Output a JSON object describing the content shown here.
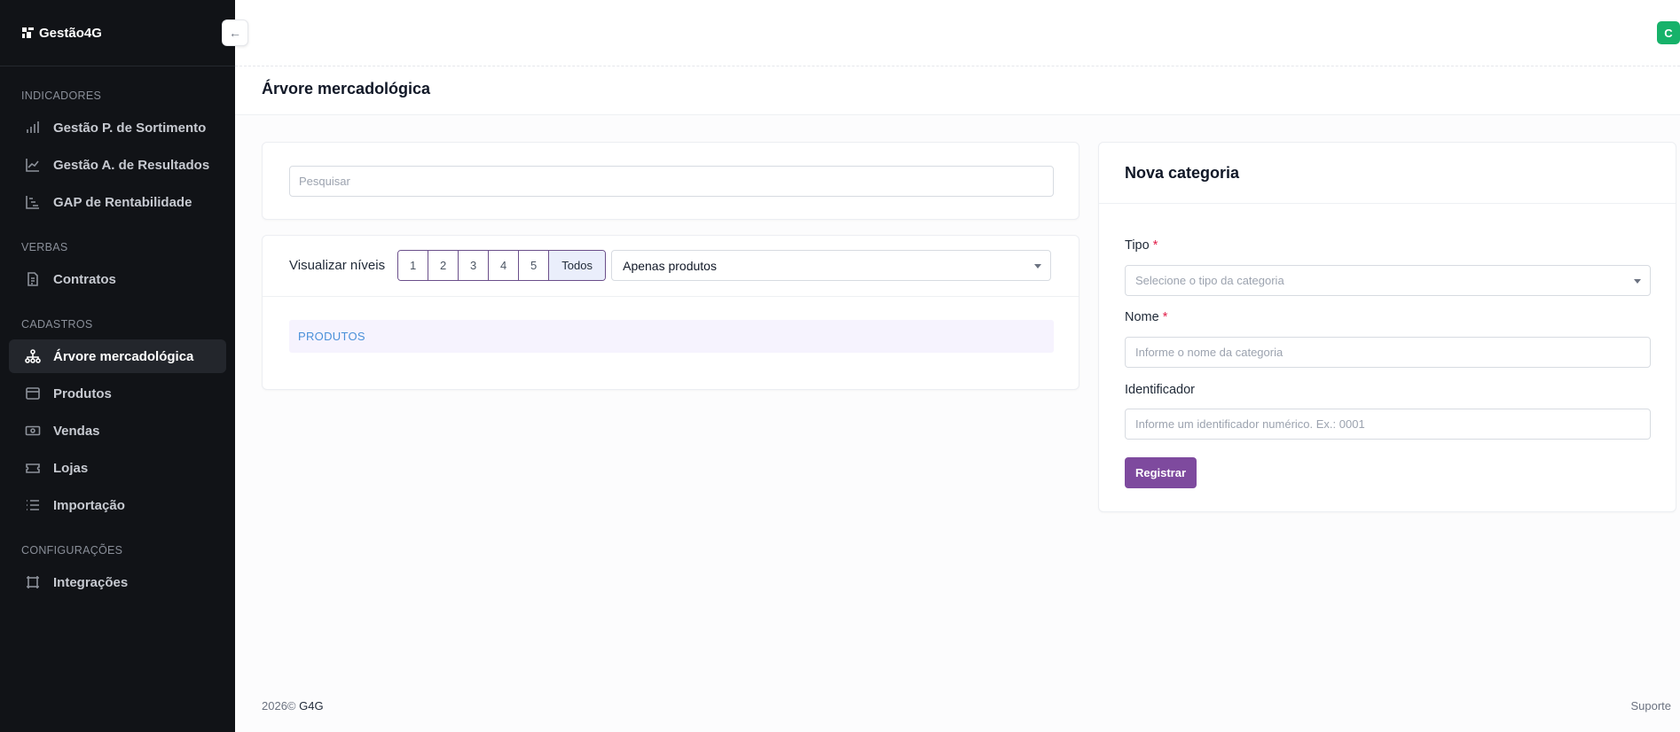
{
  "brand": {
    "name": "Gestão4G"
  },
  "sidebar": {
    "sections": [
      {
        "title": "INDICADORES",
        "items": [
          {
            "label": "Gestão P. de Sortimento",
            "icon": "bar-chart-icon"
          },
          {
            "label": "Gestão A. de Resultados",
            "icon": "line-chart-icon"
          },
          {
            "label": "GAP de Rentabilidade",
            "icon": "gantt-icon"
          }
        ]
      },
      {
        "title": "VERBAS",
        "items": [
          {
            "label": "Contratos",
            "icon": "document-icon"
          }
        ]
      },
      {
        "title": "CADASTROS",
        "items": [
          {
            "label": "Árvore mercadológica",
            "icon": "hierarchy-icon",
            "active": true
          },
          {
            "label": "Produtos",
            "icon": "box-icon"
          },
          {
            "label": "Vendas",
            "icon": "cash-icon"
          },
          {
            "label": "Lojas",
            "icon": "ticket-icon"
          },
          {
            "label": "Importação",
            "icon": "list-icon"
          }
        ]
      },
      {
        "title": "CONFIGURAÇÕES",
        "items": [
          {
            "label": "Integrações",
            "icon": "frame-icon"
          }
        ]
      }
    ]
  },
  "header": {
    "avatar_initial": "C",
    "collapse_arrow": "←"
  },
  "page": {
    "title": "Árvore mercadológica"
  },
  "search": {
    "placeholder": "Pesquisar"
  },
  "levels": {
    "label": "Visualizar níveis",
    "buttons": [
      "1",
      "2",
      "3",
      "4",
      "5"
    ],
    "all_label": "Todos",
    "filter_value": "Apenas produtos"
  },
  "tree": {
    "root_label": "PRODUTOS"
  },
  "form": {
    "title": "Nova categoria",
    "tipo_label": "Tipo",
    "tipo_placeholder": "Selecione o tipo da categoria",
    "nome_label": "Nome",
    "nome_placeholder": "Informe o nome da categoria",
    "identificador_label": "Identificador",
    "identificador_placeholder": "Informe um identificador numérico. Ex.: 0001",
    "required_mark": "*",
    "submit_label": "Registrar"
  },
  "footer": {
    "year": "2026©",
    "brand": "G4G",
    "support": "Suporte"
  },
  "colors": {
    "accent": "#7e4a9e",
    "sidebar_bg": "#111317",
    "avatar": "#17b26a",
    "tree_link": "#4a90d9"
  }
}
